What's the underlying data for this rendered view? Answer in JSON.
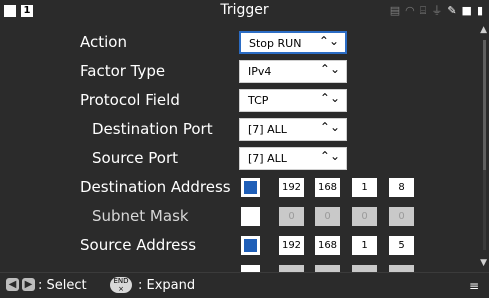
{
  "header": {
    "title": "Trigger",
    "window_number": "1"
  },
  "form": {
    "action": {
      "label": "Action",
      "value": "Stop RUN"
    },
    "factor_type": {
      "label": "Factor Type",
      "value": "IPv4"
    },
    "protocol_field": {
      "label": "Protocol Field",
      "value": "TCP"
    },
    "destination_port": {
      "label": "Destination Port",
      "value": "[7] ALL"
    },
    "source_port": {
      "label": "Source Port",
      "value": "[7] ALL"
    },
    "destination_address": {
      "label": "Destination Address",
      "octets": [
        "192",
        "168",
        "1",
        "8"
      ],
      "checked": true
    },
    "subnet_mask": {
      "label": "Subnet Mask",
      "octets": [
        "0",
        "0",
        "0",
        "0"
      ],
      "checked": false
    },
    "source_address": {
      "label": "Source Address",
      "octets": [
        "192",
        "168",
        "1",
        "5"
      ],
      "checked": true
    }
  },
  "footer": {
    "select_text": ": Select",
    "expand_text": ": Expand",
    "end_key_top": "END",
    "end_key_bottom": "×"
  },
  "icons": {
    "status": [
      "printer-icon",
      "wifi-icon",
      "network-icon",
      "usb-icon",
      "pen-icon",
      "lock-icon",
      "battery-icon"
    ]
  },
  "colors": {
    "accent": "#1f5fb8",
    "background": "#2b2b2b"
  }
}
